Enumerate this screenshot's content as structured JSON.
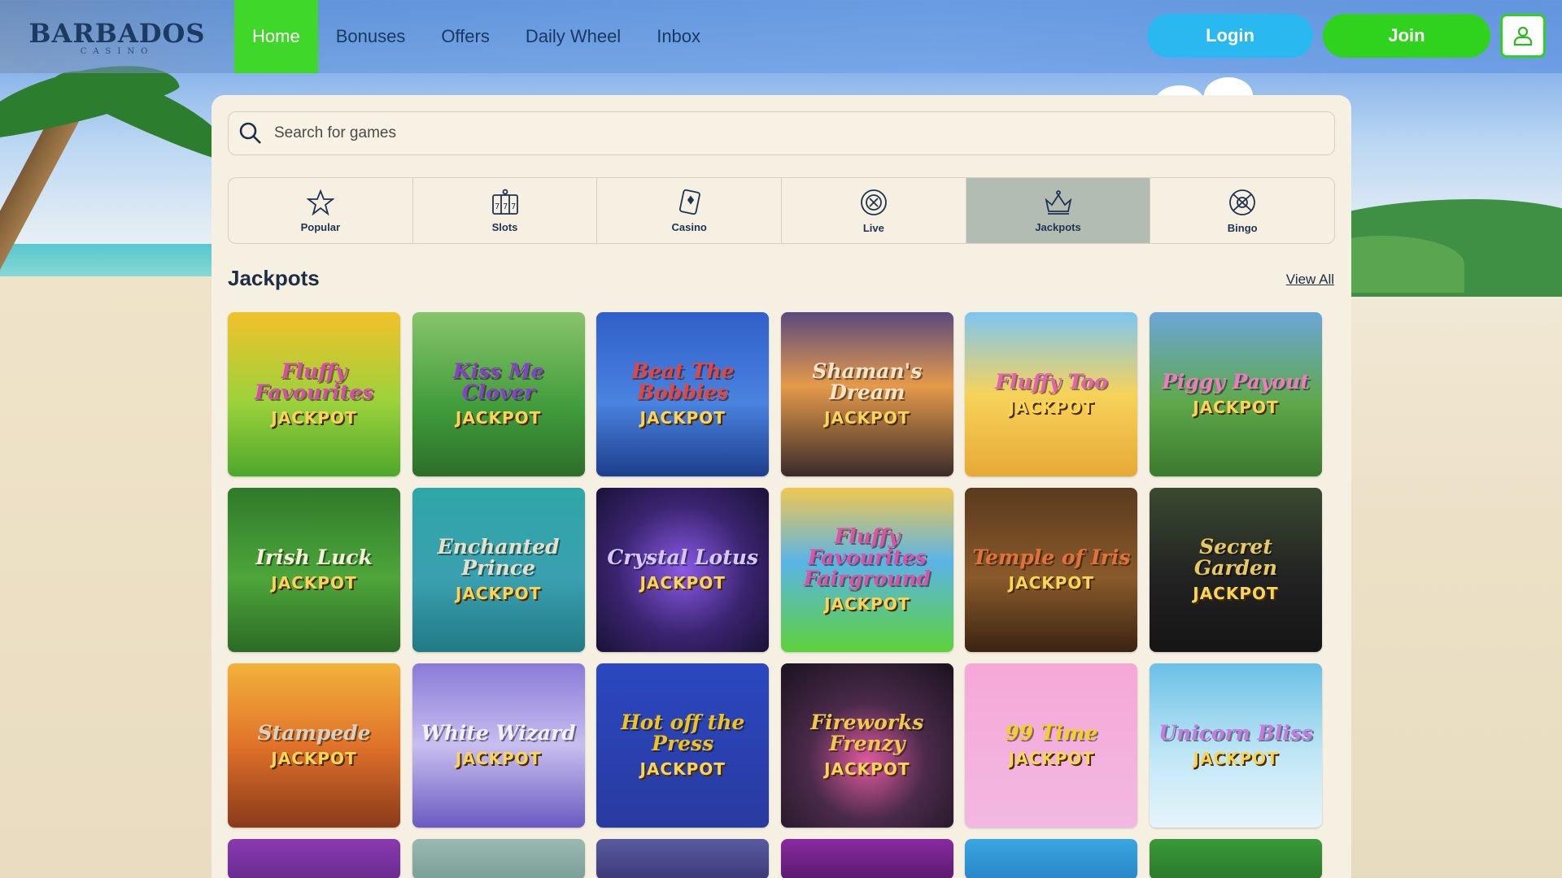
{
  "header": {
    "logo": {
      "main": "BARBADOS",
      "sub": "CASINO"
    },
    "nav": [
      {
        "label": "Home",
        "active": true
      },
      {
        "label": "Bonuses",
        "active": false
      },
      {
        "label": "Offers",
        "active": false
      },
      {
        "label": "Daily Wheel",
        "active": false
      },
      {
        "label": "Inbox",
        "active": false
      }
    ],
    "login_label": "Login",
    "join_label": "Join",
    "profile_icon": "user-icon"
  },
  "search": {
    "placeholder": "Search for games",
    "value": "",
    "icon": "search-icon"
  },
  "categories": [
    {
      "label": "Popular",
      "icon": "star-icon",
      "active": false
    },
    {
      "label": "Slots",
      "icon": "slot-machine-icon",
      "active": false
    },
    {
      "label": "Casino",
      "icon": "cards-icon",
      "active": false
    },
    {
      "label": "Live",
      "icon": "roulette-chip-icon",
      "active": false
    },
    {
      "label": "Jackpots",
      "icon": "crown-icon",
      "active": true
    },
    {
      "label": "Bingo",
      "icon": "bingo-ball-icon",
      "active": false
    }
  ],
  "section": {
    "title": "Jackpots",
    "view_all": "View All"
  },
  "games": [
    {
      "name": "Fluffy Favourites",
      "jackpot": "JACKPOT",
      "bg": "linear-gradient(180deg,#f2c12a 0%,#9bd23b 55%,#4ea62a 100%)",
      "color": "#d94bb0"
    },
    {
      "name": "Kiss Me Clover",
      "jackpot": "JACKPOT",
      "bg": "linear-gradient(180deg,#88c46a 0%,#3f9b3a 60%,#2d6e2a 100%)",
      "color": "#8a3fc8"
    },
    {
      "name": "Beat The Bobbies",
      "jackpot": "JACKPOT",
      "bg": "linear-gradient(180deg,#2f5fc8 0%,#4a83e0 55%,#1d3e8c 100%)",
      "color": "#e8443a"
    },
    {
      "name": "Shaman's Dream",
      "jackpot": "JACKPOT",
      "bg": "linear-gradient(180deg,#5a4a7e 0%,#e59a4a 45%,#3a2a2a 100%)",
      "color": "#f4e4c8"
    },
    {
      "name": "Fluffy Too",
      "jackpot": "JACKPOT",
      "bg": "linear-gradient(180deg,#7cc6f2 0%,#f6d35a 50%,#e7a936 100%)",
      "color": "#e85fb6"
    },
    {
      "name": "Piggy Payout",
      "jackpot": "JACKPOT",
      "bg": "linear-gradient(180deg,#6aa6d8 0%,#5fa84a 55%,#3a7a2e 100%)",
      "color": "#f07ac0"
    },
    {
      "name": "Irish Luck",
      "jackpot": "JACKPOT",
      "bg": "linear-gradient(180deg,#2f7a2a 0%,#4ea63a 55%,#2c6a25 100%)",
      "color": "#f4f0d8"
    },
    {
      "name": "Enchanted Prince",
      "jackpot": "JACKPOT",
      "bg": "linear-gradient(180deg,#2fa6a6 0%,#3aa0b0 55%,#217a84 100%)",
      "color": "#e6e0c8"
    },
    {
      "name": "Crystal Lotus",
      "jackpot": "JACKPOT",
      "bg": "radial-gradient(circle at 50% 50%,#8a5ae6 0%,#3a2470 55%,#1a1238 100%)",
      "color": "#d6c8ff"
    },
    {
      "name": "Fluffy Favourites Fairground",
      "jackpot": "JACKPOT",
      "bg": "linear-gradient(180deg,#f0c850 0%,#5ab4e6 45%,#5ed23a 100%)",
      "color": "#e04fa8"
    },
    {
      "name": "Temple of Iris",
      "jackpot": "JACKPOT",
      "bg": "linear-gradient(180deg,#5a3a1e 0%,#8a5a2a 55%,#3a2412 100%)",
      "color": "#e2723a"
    },
    {
      "name": "Secret Garden",
      "jackpot": "JACKPOT",
      "bg": "linear-gradient(180deg,#3a4a30 0%,#222222 55%,#151515 100%)",
      "color": "#e8c864"
    },
    {
      "name": "Stampede",
      "jackpot": "JACKPOT",
      "bg": "linear-gradient(180deg,#f2b23a 0%,#e0722a 50%,#8a3a1a 100%)",
      "color": "#d8d0c0"
    },
    {
      "name": "White Wizard",
      "jackpot": "JACKPOT",
      "bg": "linear-gradient(180deg,#8a7ad8 0%,#c8bff0 50%,#6a5ac0 100%)",
      "color": "#f4f0ff"
    },
    {
      "name": "Hot off the Press",
      "jackpot": "JACKPOT",
      "bg": "linear-gradient(180deg,#2a48c0 0%,#2a3aa0 100%)",
      "color": "#f2c21a"
    },
    {
      "name": "Fireworks Frenzy",
      "jackpot": "JACKPOT",
      "bg": "radial-gradient(circle at 50% 60%,#e05aa0 0%,#4a2a4a 45%,#1a1220 100%)",
      "color": "#f2c84a"
    },
    {
      "name": "99 Time",
      "jackpot": "JACKPOT",
      "bg": "linear-gradient(180deg,#f6a8d8 0%,#f2b8e2 100%)",
      "color": "#f2d21a"
    },
    {
      "name": "Unicorn Bliss",
      "jackpot": "JACKPOT",
      "bg": "linear-gradient(180deg,#6ac0e6 0%,#bfe6f6 55%,#e6f4fa 100%)",
      "color": "#c87ae0"
    },
    {
      "name": "",
      "jackpot": "",
      "bg": "linear-gradient(180deg,#8a3ab0,#6a2a90)",
      "color": "#ffffff"
    },
    {
      "name": "",
      "jackpot": "",
      "bg": "linear-gradient(180deg,#9ab8b0,#7aa098)",
      "color": "#ffffff"
    },
    {
      "name": "",
      "jackpot": "",
      "bg": "linear-gradient(180deg,#5a5aa0,#3a3a7a)",
      "color": "#ffffff"
    },
    {
      "name": "",
      "jackpot": "",
      "bg": "linear-gradient(180deg,#8a2aa0,#5a1a70)",
      "color": "#ffffff"
    },
    {
      "name": "",
      "jackpot": "",
      "bg": "linear-gradient(180deg,#3aa6e0,#2a86c8)",
      "color": "#ffffff"
    },
    {
      "name": "",
      "jackpot": "",
      "bg": "linear-gradient(180deg,#3a9a3a,#2a7a2a)",
      "color": "#ffffff"
    }
  ]
}
